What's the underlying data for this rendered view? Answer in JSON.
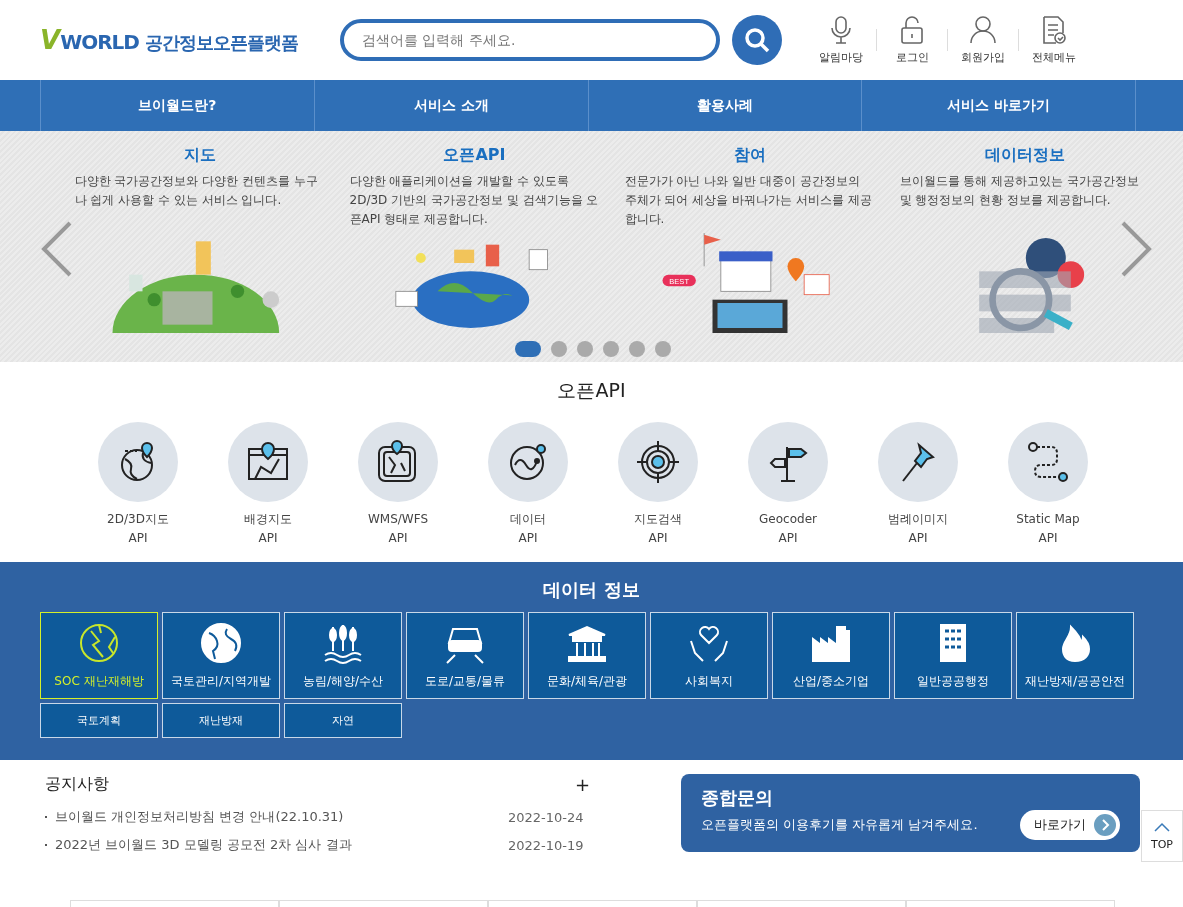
{
  "header": {
    "logo_mark": "V",
    "logo_word": "WORLD",
    "logo_title": "공간정보오픈플랫폼",
    "search": {
      "placeholder": "검색어를 입력해 주세요."
    },
    "utilities": [
      {
        "kind": "mic",
        "label": "알림마당"
      },
      {
        "kind": "lock",
        "label": "로그인"
      },
      {
        "kind": "user",
        "label": "회원가입"
      },
      {
        "kind": "doc",
        "label": "전체메뉴"
      }
    ]
  },
  "nav": [
    "브이월드란?",
    "서비스 소개",
    "활용사례",
    "서비스 바로가기"
  ],
  "carousel": {
    "slides": [
      {
        "kind": "globe",
        "title": "지도",
        "text": "다양한 국가공간정보와 다양한 컨텐츠를 누구나 쉽게 사용할 수 있는 서비스 입니다."
      },
      {
        "kind": "earth",
        "title": "오픈API",
        "text": "다양한 애플리케이션을 개발할 수 있도록 2D/3D 기반의 국가공간정보 및 검색기능을 오픈API 형태로 제공합니다."
      },
      {
        "kind": "shop",
        "title": "참여",
        "text": "전문가가 아닌 나와 일반 대중이 공간정보의 주체가 되어 세상을 바꿔나가는 서비스를 제공합니다."
      },
      {
        "kind": "gears",
        "title": "데이터정보",
        "text": "브이월드를 통해 제공하고있는 국가공간정보 및 행정정보의 현황 정보를 제공합니다."
      }
    ],
    "badge": "BEST",
    "dots": [
      {
        "selected": true
      },
      {
        "selected": false
      },
      {
        "selected": false
      },
      {
        "selected": false
      },
      {
        "selected": false
      },
      {
        "selected": false
      }
    ]
  },
  "open_api": {
    "title": "오픈API",
    "items": [
      {
        "kind": "globe",
        "name": "2D/3D지도",
        "suffix": "API"
      },
      {
        "kind": "map",
        "name": "배경지도",
        "suffix": "API"
      },
      {
        "kind": "tile",
        "name": "WMS/WFS",
        "suffix": "API"
      },
      {
        "kind": "data",
        "name": "데이터",
        "suffix": "API"
      },
      {
        "kind": "target",
        "name": "지도검색",
        "suffix": "API"
      },
      {
        "kind": "sign",
        "name": "Geocoder",
        "suffix": "API"
      },
      {
        "kind": "pin",
        "name": "범례이미지",
        "suffix": "API"
      },
      {
        "kind": "route",
        "name": "Static Map",
        "suffix": "API"
      }
    ]
  },
  "data_info": {
    "title": "데이터 정보",
    "categories": [
      {
        "kind": "soc",
        "label": "SOC 재난재해방",
        "selected": true
      },
      {
        "kind": "globe",
        "label": "국토관리/지역개발",
        "selected": false
      },
      {
        "kind": "wheat",
        "label": "농림/해양/수산",
        "selected": false
      },
      {
        "kind": "car",
        "label": "도로/교통/물류",
        "selected": false
      },
      {
        "kind": "temple",
        "label": "문화/체육/관광",
        "selected": false
      },
      {
        "kind": "heart",
        "label": "사회복지",
        "selected": false
      },
      {
        "kind": "factory",
        "label": "산업/중소기업",
        "selected": false
      },
      {
        "kind": "building",
        "label": "일반공공행정",
        "selected": false
      },
      {
        "kind": "fire",
        "label": "재난방재/공공안전",
        "selected": false
      }
    ],
    "subcategories": [
      "국토계획",
      "재난방재",
      "자연"
    ]
  },
  "notices": {
    "title": "공지사항",
    "more": "+",
    "items": [
      {
        "title": "브이월드 개인정보처리방침 변경 안내(22.10.31)",
        "date": "2022-10-24"
      },
      {
        "title": "2022년 브이월드 3D 모델링 공모전 2차 심사 결과",
        "date": "2022-10-19"
      }
    ]
  },
  "inquiry": {
    "title": "종합문의",
    "text": "오픈플랫폼의 이용후기를 자유롭게 남겨주세요.",
    "button": "바로가기"
  },
  "top_button": "TOP"
}
